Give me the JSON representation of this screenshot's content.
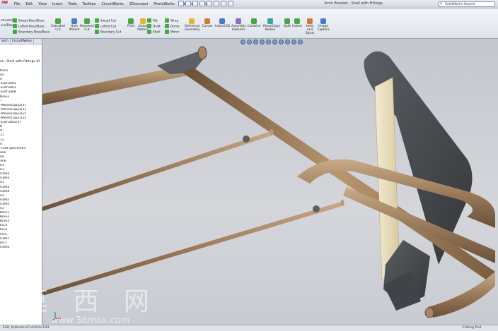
{
  "window": {
    "logo": "SW",
    "title": "3mm Bracket - Shell with Fittings",
    "search_placeholder": "SolidWorks Search"
  },
  "menu": [
    "File",
    "Edit",
    "View",
    "Insert",
    "Tools",
    "Toolbox",
    "CircuitWorks",
    "3Dconnexi",
    "PhotoWorks",
    "Window",
    "Help"
  ],
  "ribbon": {
    "big_tools": [
      {
        "label": "Extruded Cut",
        "color": "#48a64a"
      },
      {
        "label": "Hole Wizard",
        "color": "#4a79c8"
      },
      {
        "label": "Revolved Cut",
        "color": "#48a64a"
      },
      {
        "label": "Fillet",
        "color": "#48a64a"
      },
      {
        "label": "Linear Pattern",
        "color": "#e6b43a"
      },
      {
        "label": "Reference Geometry",
        "color": "#e6b43a"
      },
      {
        "label": "Curves",
        "color": "#d17a36"
      },
      {
        "label": "Instant3D",
        "color": "#4a79c8"
      },
      {
        "label": "Assembly Features",
        "color": "#8e6fb8"
      },
      {
        "label": "Combine",
        "color": "#48a64a"
      },
      {
        "label": "Move/Copy Bodies",
        "color": "#3aa3a0"
      },
      {
        "label": "Split",
        "color": "#48a64a"
      },
      {
        "label": "Indent",
        "color": "#48a64a"
      },
      {
        "label": "Helix and Spiral",
        "color": "#d17a36"
      },
      {
        "label": "Image Capture",
        "color": "#4a79c8"
      }
    ],
    "left_rows": [
      "Swept Boss/Base",
      "Lofted Boss/Base",
      "Boundary Boss/Base"
    ],
    "left_partial": [
      "xtruded",
      "oss/Base"
    ],
    "cut_rows": [
      "Swept Cut",
      "Lofted Cut",
      "Boundary Cut"
    ],
    "rib_rows": [
      "Rib",
      "Draft",
      "Shell"
    ],
    "wrap_rows": [
      "Wrap",
      "Dome",
      "Mirror"
    ]
  },
  "pane": {
    "tabs": [
      "atch",
      "CircuitWorks"
    ],
    "document": "et - Shell with Fittings (D",
    "tree": [
      "tions",
      "(s)",
      "e",
      "-Extrude5",
      "-Extrude3",
      "-Extrude8",
      "bine3",
      "7",
      "-Move/Copy2[1]",
      "-Move/Copy1[1]",
      "-Move/Copy2[2]",
      "-Move/Copy1[2]",
      "-Extrude2[3]",
      "8",
      "9",
      "11",
      "12",
      "n",
      "<not specified>",
      "ane",
      "ne",
      "ane",
      "",
      "n1",
      "",
      "",
      "",
      "n3",
      "rude2",
      "rude3",
      "e1",
      "rude3",
      "rude4",
      "e2",
      "rude2",
      "rude5",
      "e3",
      "",
      "",
      "bine1",
      "Bine2",
      "Bine3",
      "",
      "ln13",
      "ln14",
      "ln15",
      "rude7",
      "ln17",
      "rude2"
    ]
  },
  "status": {
    "left": "Edit, features of solid to Edit",
    "right": "Editing Part"
  },
  "watermark": {
    "cn": "莫 西 网",
    "url": "www.3dmox.com"
  },
  "colors": {
    "tube": "#9a7a5a",
    "tube_highlight": "#c9ab88",
    "plate": "#e8dcb8",
    "bracket_dark": "#4a4d52"
  }
}
